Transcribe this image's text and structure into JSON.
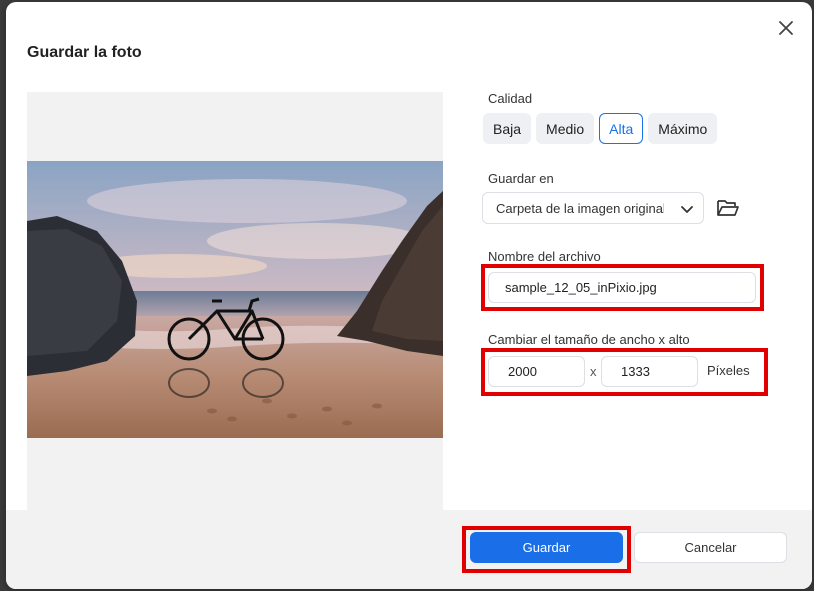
{
  "dialog": {
    "title": "Guardar la foto"
  },
  "quality": {
    "label": "Calidad",
    "options": [
      "Baja",
      "Medio",
      "Alta",
      "Máximo"
    ],
    "selected": "Alta"
  },
  "save_location": {
    "label": "Guardar en",
    "value": "Carpeta de la imagen original"
  },
  "file_name": {
    "label": "Nombre del archivo",
    "value": "sample_12_05_inPixio.jpg"
  },
  "resize": {
    "label": "Cambiar el tamaño de ancho x alto",
    "width": "2000",
    "separator": "x",
    "height": "1333",
    "unit": "Píxeles"
  },
  "footer": {
    "save_label": "Guardar",
    "cancel_label": "Cancelar"
  },
  "colors": {
    "accent": "#1a6fe8",
    "highlight": "#e00000"
  }
}
